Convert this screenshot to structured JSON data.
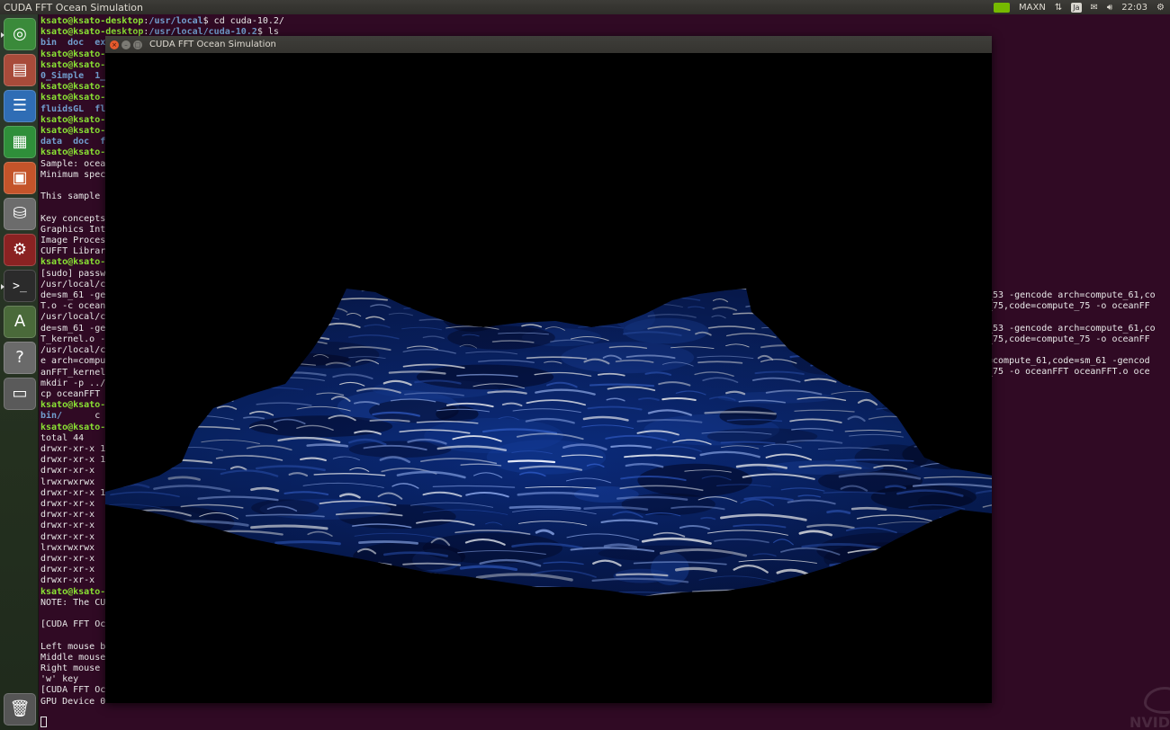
{
  "panel": {
    "app_title": "CUDA FFT Ocean Simulation",
    "perf_mode": "MAXN",
    "keyboard_layout": "Ja",
    "clock": "22:03"
  },
  "launcher": {
    "items": [
      {
        "name": "ubuntu-dash",
        "icon": "ubuntu-logo",
        "color": "#3a8a3a"
      },
      {
        "name": "files",
        "icon": "file-cabinet",
        "color": "#a84b3a"
      },
      {
        "name": "writer",
        "icon": "document",
        "color": "#2f6db5"
      },
      {
        "name": "calc",
        "icon": "spreadsheet",
        "color": "#2f8f3a"
      },
      {
        "name": "impress",
        "icon": "presentation",
        "color": "#c4542a"
      },
      {
        "name": "software-center",
        "icon": "shopping-bag",
        "color": "#6c6c6c"
      },
      {
        "name": "system-settings",
        "icon": "gear-wrench",
        "color": "#8a2222"
      },
      {
        "name": "terminal",
        "icon": "terminal",
        "color": "#2b2b2b"
      },
      {
        "name": "software-updater",
        "icon": "update-a",
        "color": "#4a6a3a"
      },
      {
        "name": "help",
        "icon": "question-mark",
        "color": "#6a6a6a"
      },
      {
        "name": "disk",
        "icon": "drive",
        "color": "#5a5a5a"
      },
      {
        "name": "trash",
        "icon": "trash-bin",
        "color": "#555555"
      }
    ]
  },
  "terminal": {
    "lines": [
      [
        {
          "t": "ksato@ksato-desktop",
          "c": "pg"
        },
        {
          "t": ":"
        },
        {
          "t": "/usr/local",
          "c": "pb"
        },
        {
          "t": "$ cd cuda-10.2/"
        }
      ],
      [
        {
          "t": "ksato@ksato-desktop",
          "c": "pg"
        },
        {
          "t": ":"
        },
        {
          "t": "/usr/local/cuda-10.2",
          "c": "pb"
        },
        {
          "t": "$ ls"
        }
      ],
      [
        {
          "t": "bin  doc  ex",
          "c": "dir"
        }
      ],
      [
        {
          "t": "ksato@ksato-",
          "c": "pg"
        }
      ],
      [
        {
          "t": "ksato@ksato-",
          "c": "pg"
        }
      ],
      [
        {
          "t": "0_Simple  1_",
          "c": "dir"
        }
      ],
      [
        {
          "t": "ksato@ksato-",
          "c": "pg"
        }
      ],
      [
        {
          "t": "ksato@ksato-",
          "c": "pg"
        }
      ],
      [
        {
          "t": "fluidsGL  fl",
          "c": "dir"
        }
      ],
      [
        {
          "t": "ksato@ksato-",
          "c": "pg"
        }
      ],
      [
        {
          "t": "ksato@ksato-",
          "c": "pg"
        }
      ],
      [
        {
          "t": "data  doc  f",
          "c": "dir"
        }
      ],
      [
        {
          "t": "ksato@ksato-",
          "c": "pg"
        }
      ],
      [
        {
          "t": "Sample: ocea"
        }
      ],
      [
        {
          "t": "Minimum spec"
        }
      ],
      [
        {
          "t": ""
        }
      ],
      [
        {
          "t": "This sample"
        }
      ],
      [
        {
          "t": ""
        }
      ],
      [
        {
          "t": "Key concepts"
        }
      ],
      [
        {
          "t": "Graphics Int"
        }
      ],
      [
        {
          "t": "Image Proces"
        }
      ],
      [
        {
          "t": "CUFFT Librar"
        }
      ],
      [
        {
          "t": "ksato@ksato-",
          "c": "pg"
        }
      ],
      [
        {
          "t": "[sudo] passw"
        }
      ],
      [
        {
          "t": "/usr/local/c"
        }
      ],
      [
        {
          "t": "de=sm_61 -ge"
        }
      ],
      [
        {
          "t": "T.o -c ocean"
        }
      ],
      [
        {
          "t": "/usr/local/c"
        }
      ],
      [
        {
          "t": "de=sm_61 -ge"
        }
      ],
      [
        {
          "t": "T_kernel.o -"
        }
      ],
      [
        {
          "t": "/usr/local/c"
        }
      ],
      [
        {
          "t": "e arch=compu"
        }
      ],
      [
        {
          "t": "anFFT_kernel"
        }
      ],
      [
        {
          "t": "mkdir -p ../"
        }
      ],
      [
        {
          "t": "cp oceanFFT "
        }
      ],
      [
        {
          "t": "ksato@ksato-",
          "c": "pg"
        }
      ],
      [
        {
          "t": "bin/",
          "c": "dir"
        },
        {
          "t": "      c"
        }
      ],
      [
        {
          "t": "ksato@ksato-",
          "c": "pg"
        }
      ],
      [
        {
          "t": "total 44"
        }
      ],
      [
        {
          "t": "drwxr-xr-x 1"
        }
      ],
      [
        {
          "t": "drwxr-xr-x 1"
        }
      ],
      [
        {
          "t": "drwxr-xr-x "
        }
      ],
      [
        {
          "t": "lrwxrwxrwx "
        }
      ],
      [
        {
          "t": "drwxr-xr-x 1"
        }
      ],
      [
        {
          "t": "drwxr-xr-x "
        }
      ],
      [
        {
          "t": "drwxr-xr-x "
        }
      ],
      [
        {
          "t": "drwxr-xr-x "
        }
      ],
      [
        {
          "t": "drwxr-xr-x "
        }
      ],
      [
        {
          "t": "lrwxrwxrwx "
        }
      ],
      [
        {
          "t": "drwxr-xr-x "
        }
      ],
      [
        {
          "t": "drwxr-xr-x "
        }
      ],
      [
        {
          "t": "drwxr-xr-x "
        }
      ],
      [
        {
          "t": "ksato@ksato-",
          "c": "pg"
        }
      ],
      [
        {
          "t": "NOTE: The CU"
        }
      ],
      [
        {
          "t": ""
        }
      ],
      [
        {
          "t": "[CUDA FFT Oc"
        }
      ],
      [
        {
          "t": ""
        }
      ],
      [
        {
          "t": "Left mouse b"
        }
      ],
      [
        {
          "t": "Middle mouse"
        }
      ],
      [
        {
          "t": "Right mouse "
        }
      ],
      [
        {
          "t": "'w' key"
        }
      ],
      [
        {
          "t": "[CUDA FFT Oc"
        }
      ],
      [
        {
          "t": "GPU Device 0"
        }
      ]
    ],
    "right_lines": [
      {
        "row": 25,
        "text": "_53 -gencode arch=compute_61,co"
      },
      {
        "row": 26,
        "text": "_75,code=compute_75 -o oceanFF"
      },
      {
        "row": 28,
        "text": "_53 -gencode arch=compute_61,co"
      },
      {
        "row": 29,
        "text": "_75,code=compute_75 -o oceanFF"
      },
      {
        "row": 31,
        "text": "=compute_61,code=sm_61 -gencod"
      },
      {
        "row": 32,
        "text": "_75 -o oceanFFT oceanFFT.o oce"
      }
    ],
    "watermark": "NVIDIA."
  },
  "window": {
    "title": "CUDA FFT Ocean Simulation",
    "close_glyph": "×",
    "min_glyph": "–",
    "max_glyph": "□"
  },
  "ocean": {
    "surface_dark": "#02082a",
    "surface_mid": "#0c2f82",
    "highlight": "#dfe8ff"
  }
}
